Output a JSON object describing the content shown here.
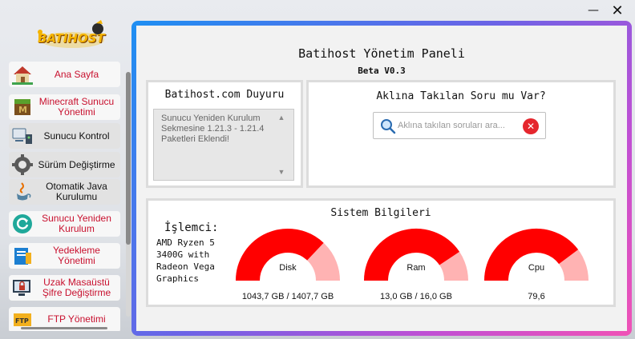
{
  "window": {
    "minimize_glyph": "—",
    "close_glyph": "✕"
  },
  "logo": {
    "text": "BATIHOST"
  },
  "sidebar": {
    "items": [
      {
        "label": "Ana Sayfa",
        "icon": "house-icon"
      },
      {
        "label": "Minecraft Sunucu Yönetimi",
        "icon": "minecraft-icon"
      },
      {
        "label": "Sunucu Kontrol",
        "icon": "server-control-icon"
      },
      {
        "label": "Sürüm Değiştirme",
        "icon": "version-gear-icon"
      },
      {
        "label": "Otomatik Java Kurulumu",
        "icon": "java-icon"
      },
      {
        "label": "Sunucu Yeniden Kurulum",
        "icon": "reinstall-icon"
      },
      {
        "label": "Yedekleme Yönetimi",
        "icon": "backup-icon"
      },
      {
        "label": "Uzak Masaüstü Şifre Değiştirme",
        "icon": "remote-desktop-lock-icon"
      },
      {
        "label": "FTP Yönetimi",
        "icon": "ftp-icon"
      }
    ]
  },
  "main": {
    "title": "Batihost Yönetim Paneli",
    "version": "Beta V0.3",
    "announcements": {
      "title": "Batihost.com Duyuru",
      "text": "Sunucu Yeniden Kurulum Sekmesine 1.21.3 - 1.21.4 Paketleri Eklendi!"
    },
    "question": {
      "title": "Aklına Takılan Soru mu Var?",
      "search_placeholder": "Aklına takılan soruları ara..."
    },
    "system": {
      "title": "Sistem Bilgileri",
      "cpu_label": "İşlemci:",
      "cpu_name": "AMD Ryzen 5 3400G with Radeon Vega Graphics",
      "gauges": [
        {
          "name": "Disk",
          "value_text": "1043,7 GB / 1407,7 GB",
          "fraction": 0.741
        },
        {
          "name": "Ram",
          "value_text": "13,0 GB / 16,0 GB",
          "fraction": 0.8125
        },
        {
          "name": "Cpu",
          "value_text": "79,6",
          "fraction": 0.796
        }
      ]
    }
  },
  "colors": {
    "accent_red": "#ff0000",
    "gauge_track": "#ffb3b3",
    "nav_text": "#c8102e",
    "frame_gradient_start": "#1e8ff2",
    "frame_gradient_end": "#f052b6"
  }
}
